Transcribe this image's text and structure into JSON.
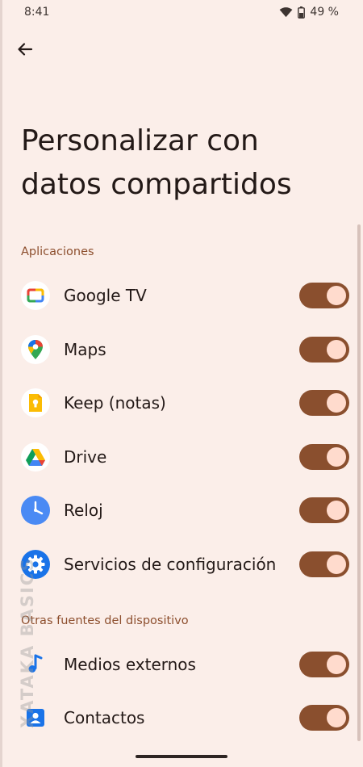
{
  "status_bar": {
    "time": "8:41",
    "battery_percent": "49 %",
    "icons": [
      "wifi-icon",
      "battery-icon"
    ]
  },
  "header": {
    "back_icon": "arrow-back-icon",
    "title": "Personalizar con datos compartidos"
  },
  "sections": {
    "apps": {
      "label": "Aplicaciones",
      "items": [
        {
          "label": "Google TV",
          "icon": "google-tv-icon",
          "enabled": true
        },
        {
          "label": "Maps",
          "icon": "maps-icon",
          "enabled": true
        },
        {
          "label": "Keep (notas)",
          "icon": "keep-icon",
          "enabled": true
        },
        {
          "label": "Drive",
          "icon": "drive-icon",
          "enabled": true
        },
        {
          "label": "Reloj",
          "icon": "clock-icon",
          "enabled": true
        },
        {
          "label": "Servicios de configuración",
          "icon": "settings-gear-icon",
          "enabled": true
        }
      ]
    },
    "device": {
      "label": "Otras fuentes del dispositivo",
      "items": [
        {
          "label": "Medios externos",
          "icon": "music-note-icon",
          "enabled": true
        },
        {
          "label": "Contactos",
          "icon": "contacts-icon",
          "enabled": true
        }
      ]
    }
  },
  "watermark": {
    "text": "XATAKA BASICS"
  },
  "colors": {
    "background": "#fbeee9",
    "accent": "#8a4f2e",
    "toggle_knob": "#ffdbcd",
    "section_header": "#8d4f2e"
  }
}
